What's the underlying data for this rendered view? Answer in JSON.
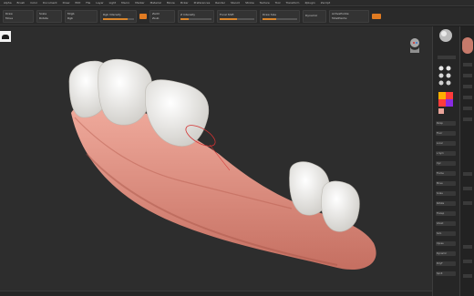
{
  "menubar": {
    "items": [
      "Alpha",
      "Brush",
      "Color",
      "Document",
      "Draw",
      "Edit",
      "File",
      "Layer",
      "Light",
      "Macro",
      "Marker",
      "Material",
      "Movie",
      "Picker",
      "Preferences",
      "Render",
      "Stencil",
      "Stroke",
      "Texture",
      "Tool",
      "Transform",
      "Zplugin",
      "Zscript"
    ]
  },
  "toolbar": {
    "draw_label": "Draw",
    "move_label": "Move",
    "scale_label": "Scale",
    "rotate_label": "Rotate",
    "mrgb_label": "Mrgb",
    "rgb_label": "Rgb",
    "m_label": "M",
    "rgb_intensity_label": "Rgb Intensity",
    "zadd_label": "Zadd",
    "zsub_label": "Zsub",
    "z_intensity_label": "Z Intensity",
    "focal_shift_label": "Focal Shift",
    "draw_size_label": "Draw Size",
    "dynamic_label": "Dynamic",
    "active_points_label": "ActivePoints:",
    "total_points_label": "TotalPoints:"
  },
  "shelf": {
    "buttons": [
      "Persp",
      "Floor",
      "Local",
      "L.Sym",
      "Xyz",
      "Frame",
      "Move",
      "Scale",
      "Rotate",
      "Transp",
      "Ghost",
      "Solo",
      "Xpose",
      "Dynamic",
      "PolyF",
      "Spotl"
    ]
  },
  "status": {
    "text": ""
  },
  "colors": {
    "accent": "#e07b22",
    "viewport_bg": "#2d2d2d",
    "gum": "#e2978a",
    "tooth": "#f1f0ed"
  },
  "icons": {
    "corner": "brush-icon",
    "nav": "head-navigation-icon"
  }
}
